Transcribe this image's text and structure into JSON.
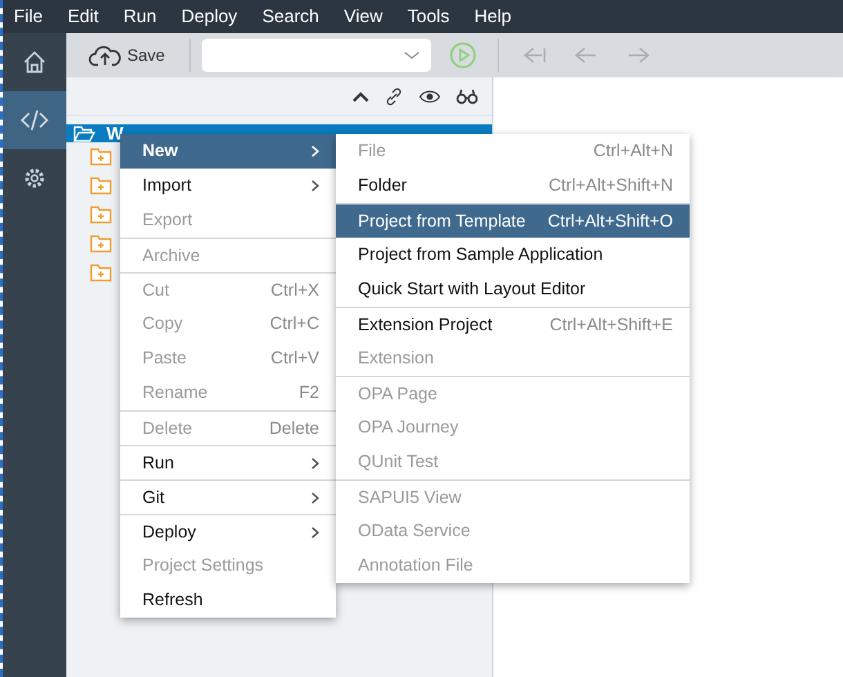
{
  "menu_bar": [
    "File",
    "Edit",
    "Run",
    "Deploy",
    "Search",
    "View",
    "Tools",
    "Help"
  ],
  "sidebar": [
    {
      "kind": "home",
      "selected": false
    },
    {
      "kind": "code",
      "selected": true
    },
    {
      "kind": "settings",
      "selected": false
    }
  ],
  "toolbar": {
    "save": "Save"
  },
  "tree": {
    "root": "W",
    "selected": true,
    "children": [
      {
        "kind": "folder"
      },
      {
        "kind": "folder"
      },
      {
        "kind": "folder"
      },
      {
        "kind": "folder"
      },
      {
        "kind": "folder"
      }
    ]
  },
  "context_menu": [
    {
      "label": "New",
      "submenu": true,
      "disabled": false,
      "selected": true,
      "separator": false
    },
    {
      "label": "Import",
      "submenu": true,
      "disabled": false,
      "selected": false,
      "separator": false
    },
    {
      "label": "Export",
      "submenu": false,
      "disabled": true,
      "selected": false,
      "separator": false
    },
    {
      "label": "Archive",
      "submenu": false,
      "disabled": true,
      "selected": false,
      "separator": true
    },
    {
      "label": "Cut",
      "shortcut": "Ctrl+X",
      "submenu": false,
      "disabled": true,
      "selected": false,
      "separator": true
    },
    {
      "label": "Copy",
      "shortcut": "Ctrl+C",
      "submenu": false,
      "disabled": true,
      "selected": false,
      "separator": false
    },
    {
      "label": "Paste",
      "shortcut": "Ctrl+V",
      "submenu": false,
      "disabled": true,
      "selected": false,
      "separator": false
    },
    {
      "label": "Rename",
      "shortcut": "F2",
      "submenu": false,
      "disabled": true,
      "selected": false,
      "separator": false
    },
    {
      "label": "Delete",
      "shortcut": "Delete",
      "submenu": false,
      "disabled": true,
      "selected": false,
      "separator": true
    },
    {
      "label": "Run",
      "submenu": true,
      "disabled": false,
      "selected": false,
      "separator": true
    },
    {
      "label": "Git",
      "submenu": true,
      "disabled": false,
      "selected": false,
      "separator": true
    },
    {
      "label": "Deploy",
      "submenu": true,
      "disabled": false,
      "selected": false,
      "separator": true
    },
    {
      "label": "Project Settings",
      "submenu": false,
      "disabled": true,
      "selected": false,
      "separator": false
    },
    {
      "label": "Refresh",
      "submenu": false,
      "disabled": false,
      "selected": false,
      "separator": false
    }
  ],
  "submenu": [
    {
      "label": "File",
      "shortcut": "Ctrl+Alt+N",
      "disabled": true,
      "selected": false,
      "separator": false
    },
    {
      "label": "Folder",
      "shortcut": "Ctrl+Alt+Shift+N",
      "disabled": false,
      "selected": false,
      "separator": false
    },
    {
      "label": "Project from Template",
      "shortcut": "Ctrl+Alt+Shift+O",
      "disabled": false,
      "selected": true,
      "separator": true
    },
    {
      "label": "Project from Sample Application",
      "disabled": false,
      "selected": false,
      "separator": false
    },
    {
      "label": "Quick Start with Layout Editor",
      "disabled": false,
      "selected": false,
      "separator": false
    },
    {
      "label": "Extension Project",
      "shortcut": "Ctrl+Alt+Shift+E",
      "disabled": false,
      "selected": false,
      "separator": true
    },
    {
      "label": "Extension",
      "disabled": true,
      "selected": false,
      "separator": false
    },
    {
      "label": "OPA Page",
      "disabled": true,
      "selected": false,
      "separator": true
    },
    {
      "label": "OPA Journey",
      "disabled": true,
      "selected": false,
      "separator": false
    },
    {
      "label": "QUnit Test",
      "disabled": true,
      "selected": false,
      "separator": false
    },
    {
      "label": "SAPUI5 View",
      "disabled": true,
      "selected": false,
      "separator": true
    },
    {
      "label": "OData Service",
      "disabled": true,
      "selected": false,
      "separator": false
    },
    {
      "label": "Annotation File",
      "disabled": true,
      "selected": false,
      "separator": false
    }
  ]
}
